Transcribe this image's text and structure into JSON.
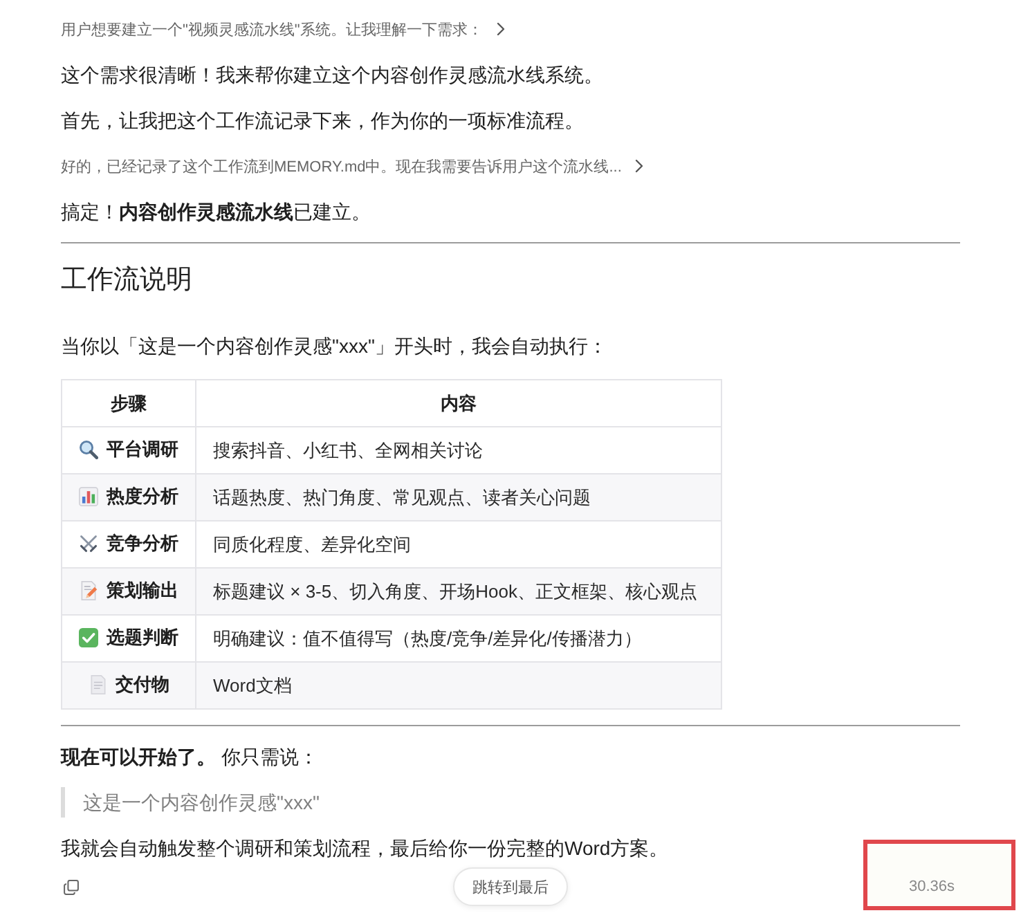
{
  "blocks": [
    {
      "kind": "thought",
      "text": "用户想要建立一个\"视频灵感流水线\"系统。让我理解一下需求："
    },
    {
      "kind": "paragraph",
      "text": "这个需求很清晰！我来帮你建立这个内容创作灵感流水线系统。"
    },
    {
      "kind": "paragraph",
      "text": "首先，让我把这个工作流记录下来，作为你的一项标准流程。"
    },
    {
      "kind": "thought",
      "text": "好的，已经记录了这个工作流到MEMORY.md中。现在我需要告诉用户这个流水线..."
    },
    {
      "kind": "paragraph",
      "text": "搞定！**内容创作灵感流水线**已建立。"
    },
    {
      "kind": "rule"
    },
    {
      "kind": "heading",
      "text": "工作流说明"
    },
    {
      "kind": "paragraph",
      "text": "当你以「这是一个内容创作灵感\"xxx\"」开头时，我会自动执行："
    },
    {
      "kind": "table",
      "columns": [
        "步骤",
        "内容"
      ],
      "rows": [
        {
          "cells": [
            "平台调研",
            "搜索抖音、小红书、全网相关讨论"
          ]
        },
        {
          "cells": [
            "热度分析",
            "话题热度、热门角度、常见观点、读者关心问题"
          ]
        },
        {
          "cells": [
            "竞争分析",
            "同质化程度、差异化空间"
          ]
        },
        {
          "cells": [
            "策划输出",
            "标题建议 × 3-5、切入角度、开场Hook、正文框架、核心观点"
          ]
        },
        {
          "cells": [
            "选题判断",
            "明确建议：值不值得写（热度/竞争/差异化/传播潜力）"
          ]
        },
        {
          "cells": [
            "交付物",
            "Word文档"
          ]
        }
      ]
    },
    {
      "kind": "rule"
    },
    {
      "kind": "paragraph",
      "text": "**现在可以开始了。** 你只需说："
    },
    {
      "kind": "quote",
      "text": "这是一个内容创作灵感\"xxx\""
    },
    {
      "kind": "paragraph",
      "text": "我就会自动触发整个调研和策划流程，最后给你一份完整的Word方案。"
    }
  ],
  "footer": {
    "jump_button": "跳转到最后",
    "elapsed": {
      "text": "30.36s",
      "highlighted": true
    }
  }
}
